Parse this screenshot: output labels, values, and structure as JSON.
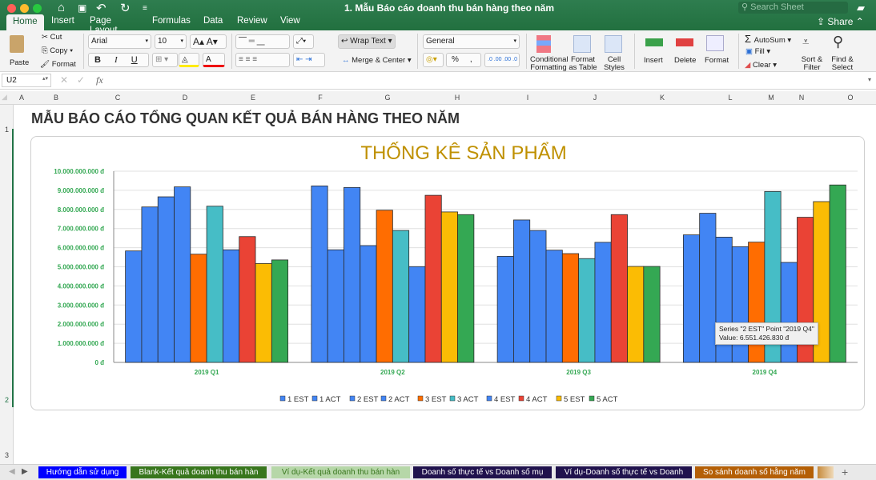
{
  "window": {
    "title": "1. Mẫu Báo cáo doanh thu bán hàng theo năm",
    "search_placeholder": "Search Sheet",
    "share": "Share"
  },
  "menu_tabs": [
    "Home",
    "Insert",
    "Page Layout",
    "Formulas",
    "Data",
    "Review",
    "View"
  ],
  "ribbon": {
    "paste": "Paste",
    "cut": "Cut",
    "copy": "Copy",
    "format_painter": "Format",
    "font": "Arial",
    "font_size": "10",
    "bold": "B",
    "italic": "I",
    "underline": "U",
    "wrap_text": "Wrap Text",
    "merge_center": "Merge & Center",
    "number_format": "General",
    "percent": "%",
    "comma": ",",
    "dec_inc": ".0 .00",
    "dec_dec": ".00 .0",
    "conditional_formatting": "Conditional Formatting",
    "format_as_table": "Format as Table",
    "cell_styles": "Cell Styles",
    "insert": "Insert",
    "delete": "Delete",
    "format": "Format",
    "autosum": "AutoSum",
    "fill": "Fill",
    "clear": "Clear",
    "sort_filter": "Sort & Filter",
    "find_select": "Find & Select"
  },
  "formula_bar": {
    "cell_ref": "U2",
    "fx": "fx",
    "value": ""
  },
  "columns": [
    "A",
    "B",
    "C",
    "D",
    "E",
    "F",
    "G",
    "H",
    "I",
    "J",
    "K",
    "L",
    "M",
    "N",
    "O"
  ],
  "rows": [
    "1",
    "2",
    "3"
  ],
  "sheet": {
    "title": "MẪU BÁO CÁO TỔNG QUAN KẾT QUẢ BÁN HÀNG THEO NĂM"
  },
  "chart_data": {
    "type": "bar",
    "title": "THỐNG KÊ SẢN PHẨM",
    "categories": [
      "2019 Q1",
      "2019 Q2",
      "2019 Q3",
      "2019 Q4"
    ],
    "ylim": [
      0,
      10000000000
    ],
    "yticks": [
      "0 đ",
      "1.000.000.000 đ",
      "2.000.000.000 đ",
      "3.000.000.000 đ",
      "4.000.000.000 đ",
      "5.000.000.000 đ",
      "6.000.000.000 đ",
      "7.000.000.000 đ",
      "8.000.000.000 đ",
      "9.000.000.000 đ",
      "10.000.000.000 đ"
    ],
    "legend_position": "bottom",
    "grid": true,
    "series": [
      {
        "name": "1 EST",
        "color": "#4285f4",
        "values": [
          5830000000,
          9230000000,
          5550000000,
          6670000000
        ]
      },
      {
        "name": "1 ACT",
        "color": "#4285f4",
        "values": [
          8130000000,
          5890000000,
          7450000000,
          7800000000
        ]
      },
      {
        "name": "2 EST",
        "color": "#4285f4",
        "values": [
          8660000000,
          9150000000,
          6900000000,
          6551426830
        ]
      },
      {
        "name": "2 ACT",
        "color": "#4285f4",
        "values": [
          9180000000,
          6110000000,
          5870000000,
          6050000000
        ]
      },
      {
        "name": "3 EST",
        "color": "#ff6d01",
        "values": [
          5660000000,
          7960000000,
          5690000000,
          6290000000
        ]
      },
      {
        "name": "3 ACT",
        "color": "#46bdc6",
        "values": [
          8170000000,
          6900000000,
          5430000000,
          8940000000
        ]
      },
      {
        "name": "4 EST",
        "color": "#4285f4",
        "values": [
          5890000000,
          5010000000,
          6280000000,
          5230000000
        ]
      },
      {
        "name": "4 ACT",
        "color": "#ea4335",
        "values": [
          6580000000,
          8740000000,
          7730000000,
          7590000000
        ]
      },
      {
        "name": "5 EST",
        "color": "#fbbc04",
        "values": [
          5170000000,
          7870000000,
          5020000000,
          8410000000
        ]
      },
      {
        "name": "5 ACT",
        "color": "#34a853",
        "values": [
          5360000000,
          7730000000,
          5020000000,
          9280000000
        ]
      }
    ],
    "tooltip": {
      "line1": "Series \"2 EST\" Point \"2019 Q4\"",
      "line2": "Value: 6.551.426.830 đ"
    }
  },
  "sheet_tabs": [
    {
      "label": "Hướng dẫn sử dụng",
      "bg": "#0000ff",
      "fg": "#ffffff"
    },
    {
      "label": "Blank-Kết quả doanh thu bán hàn",
      "bg": "#38761d",
      "fg": "#ffffff"
    },
    {
      "label": "Ví dụ-Kết quả doanh thu bán hàn",
      "bg": "#b6d7a8",
      "fg": "#38761d"
    },
    {
      "label": "Doanh số thực tế vs Doanh số mụ",
      "bg": "#20124d",
      "fg": "#ffffff"
    },
    {
      "label": "Ví dụ-Doanh số thực tế vs Doanh",
      "bg": "#20124d",
      "fg": "#ffffff"
    },
    {
      "label": "So sánh doanh số hằng năm",
      "bg": "#b45f06",
      "fg": "#ffffff"
    }
  ],
  "add_sheet": "+"
}
